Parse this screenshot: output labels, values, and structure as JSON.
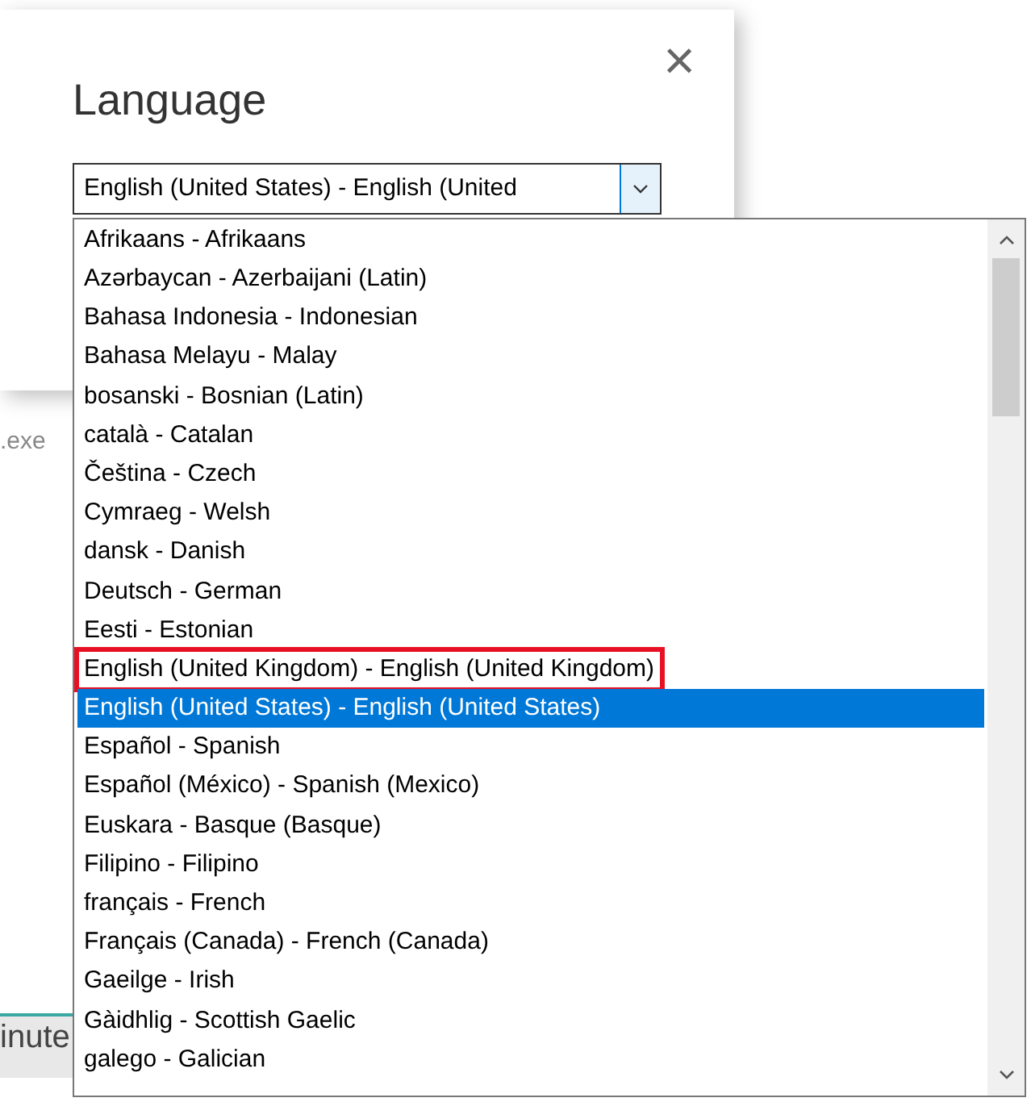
{
  "dialog": {
    "title": "Language",
    "close": "×"
  },
  "background_texts": [
    ".exe",
    "inute"
  ],
  "combo": {
    "value": "English (United States) - English (United"
  },
  "list": {
    "items": [
      {
        "label": "Afrikaans - Afrikaans",
        "selected": false,
        "outlined": false
      },
      {
        "label": "Azərbaycan - Azerbaijani (Latin)",
        "selected": false,
        "outlined": false
      },
      {
        "label": "Bahasa Indonesia - Indonesian",
        "selected": false,
        "outlined": false
      },
      {
        "label": "Bahasa Melayu - Malay",
        "selected": false,
        "outlined": false
      },
      {
        "label": "bosanski - Bosnian (Latin)",
        "selected": false,
        "outlined": false
      },
      {
        "label": "català - Catalan",
        "selected": false,
        "outlined": false
      },
      {
        "label": "Čeština - Czech",
        "selected": false,
        "outlined": false
      },
      {
        "label": "Cymraeg - Welsh",
        "selected": false,
        "outlined": false
      },
      {
        "label": "dansk - Danish",
        "selected": false,
        "outlined": false
      },
      {
        "label": "Deutsch - German",
        "selected": false,
        "outlined": false
      },
      {
        "label": "Eesti - Estonian",
        "selected": false,
        "outlined": false
      },
      {
        "label": "English (United Kingdom) - English (United Kingdom)",
        "selected": false,
        "outlined": true
      },
      {
        "label": "English (United States) - English (United States)",
        "selected": true,
        "outlined": false
      },
      {
        "label": "Español - Spanish",
        "selected": false,
        "outlined": false
      },
      {
        "label": "Español (México) - Spanish (Mexico)",
        "selected": false,
        "outlined": false
      },
      {
        "label": "Euskara - Basque (Basque)",
        "selected": false,
        "outlined": false
      },
      {
        "label": "Filipino - Filipino",
        "selected": false,
        "outlined": false
      },
      {
        "label": "français - French",
        "selected": false,
        "outlined": false
      },
      {
        "label": "Français (Canada) - French (Canada)",
        "selected": false,
        "outlined": false
      },
      {
        "label": "Gaeilge - Irish",
        "selected": false,
        "outlined": false
      },
      {
        "label": "Gàidhlig - Scottish Gaelic",
        "selected": false,
        "outlined": false
      },
      {
        "label": "galego - Galician",
        "selected": false,
        "outlined": false
      }
    ]
  }
}
